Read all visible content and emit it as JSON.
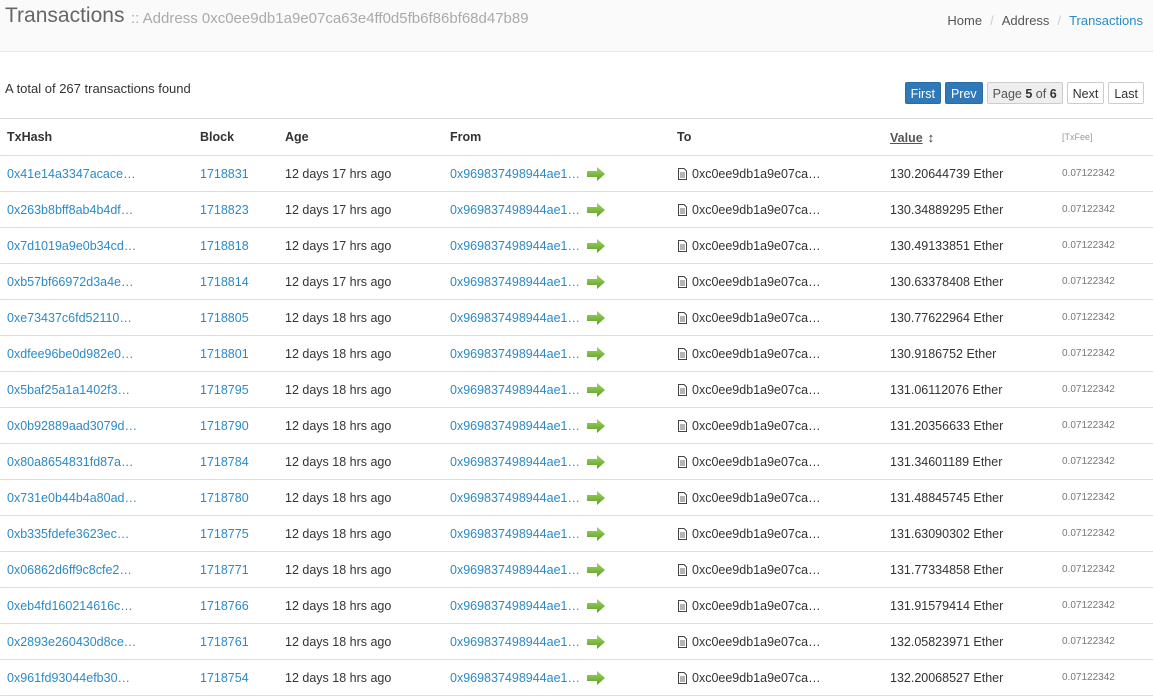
{
  "header": {
    "title": "Transactions",
    "subtitle": ":: Address 0xc0ee9db1a9e07ca63e4ff0d5fb6f86bf68d47b89",
    "breadcrumb": [
      "Home",
      "Address",
      "Transactions"
    ]
  },
  "summary": "A total of 267 transactions found",
  "pager": {
    "first": "First",
    "prev": "Prev",
    "page_label": "Page",
    "current": "5",
    "of_label": "of",
    "total": "6",
    "next": "Next",
    "last": "Last"
  },
  "columns": {
    "txhash": "TxHash",
    "block": "Block",
    "age": "Age",
    "from": "From",
    "to": "To",
    "value": "Value",
    "fee": "[TxFee]"
  },
  "colors": {
    "link": "#2a8ac8",
    "primary_button": "#2f79b9",
    "arrow_green": "#7bbf3a"
  },
  "icons": {
    "arrow": "right-arrow-icon",
    "contract": "document-icon",
    "sort": "sort-icon"
  },
  "rows": [
    {
      "hash": "0x41e14a3347acace…",
      "block": "1718831",
      "age": "12 days 17 hrs ago",
      "from": "0x969837498944ae1…",
      "to": "0xc0ee9db1a9e07ca…",
      "value": "130.20644739 Ether",
      "fee": "0.07122342"
    },
    {
      "hash": "0x263b8bff8ab4b4df…",
      "block": "1718823",
      "age": "12 days 17 hrs ago",
      "from": "0x969837498944ae1…",
      "to": "0xc0ee9db1a9e07ca…",
      "value": "130.34889295 Ether",
      "fee": "0.07122342"
    },
    {
      "hash": "0x7d1019a9e0b34cd…",
      "block": "1718818",
      "age": "12 days 17 hrs ago",
      "from": "0x969837498944ae1…",
      "to": "0xc0ee9db1a9e07ca…",
      "value": "130.49133851 Ether",
      "fee": "0.07122342"
    },
    {
      "hash": "0xb57bf66972d3a4e…",
      "block": "1718814",
      "age": "12 days 17 hrs ago",
      "from": "0x969837498944ae1…",
      "to": "0xc0ee9db1a9e07ca…",
      "value": "130.63378408 Ether",
      "fee": "0.07122342"
    },
    {
      "hash": "0xe73437c6fd52110…",
      "block": "1718805",
      "age": "12 days 18 hrs ago",
      "from": "0x969837498944ae1…",
      "to": "0xc0ee9db1a9e07ca…",
      "value": "130.77622964 Ether",
      "fee": "0.07122342"
    },
    {
      "hash": "0xdfee96be0d982e0…",
      "block": "1718801",
      "age": "12 days 18 hrs ago",
      "from": "0x969837498944ae1…",
      "to": "0xc0ee9db1a9e07ca…",
      "value": "130.9186752 Ether",
      "fee": "0.07122342"
    },
    {
      "hash": "0x5baf25a1a1402f3…",
      "block": "1718795",
      "age": "12 days 18 hrs ago",
      "from": "0x969837498944ae1…",
      "to": "0xc0ee9db1a9e07ca…",
      "value": "131.06112076 Ether",
      "fee": "0.07122342"
    },
    {
      "hash": "0x0b92889aad3079d…",
      "block": "1718790",
      "age": "12 days 18 hrs ago",
      "from": "0x969837498944ae1…",
      "to": "0xc0ee9db1a9e07ca…",
      "value": "131.20356633 Ether",
      "fee": "0.07122342"
    },
    {
      "hash": "0x80a8654831fd87a…",
      "block": "1718784",
      "age": "12 days 18 hrs ago",
      "from": "0x969837498944ae1…",
      "to": "0xc0ee9db1a9e07ca…",
      "value": "131.34601189 Ether",
      "fee": "0.07122342"
    },
    {
      "hash": "0x731e0b44b4a80ad…",
      "block": "1718780",
      "age": "12 days 18 hrs ago",
      "from": "0x969837498944ae1…",
      "to": "0xc0ee9db1a9e07ca…",
      "value": "131.48845745 Ether",
      "fee": "0.07122342"
    },
    {
      "hash": "0xb335fdefe3623ec…",
      "block": "1718775",
      "age": "12 days 18 hrs ago",
      "from": "0x969837498944ae1…",
      "to": "0xc0ee9db1a9e07ca…",
      "value": "131.63090302 Ether",
      "fee": "0.07122342"
    },
    {
      "hash": "0x06862d6ff9c8cfe2…",
      "block": "1718771",
      "age": "12 days 18 hrs ago",
      "from": "0x969837498944ae1…",
      "to": "0xc0ee9db1a9e07ca…",
      "value": "131.77334858 Ether",
      "fee": "0.07122342"
    },
    {
      "hash": "0xeb4fd160214616c…",
      "block": "1718766",
      "age": "12 days 18 hrs ago",
      "from": "0x969837498944ae1…",
      "to": "0xc0ee9db1a9e07ca…",
      "value": "131.91579414 Ether",
      "fee": "0.07122342"
    },
    {
      "hash": "0x2893e260430d8ce…",
      "block": "1718761",
      "age": "12 days 18 hrs ago",
      "from": "0x969837498944ae1…",
      "to": "0xc0ee9db1a9e07ca…",
      "value": "132.05823971 Ether",
      "fee": "0.07122342"
    },
    {
      "hash": "0x961fd93044efb30…",
      "block": "1718754",
      "age": "12 days 18 hrs ago",
      "from": "0x969837498944ae1…",
      "to": "0xc0ee9db1a9e07ca…",
      "value": "132.20068527 Ether",
      "fee": "0.07122342"
    }
  ]
}
